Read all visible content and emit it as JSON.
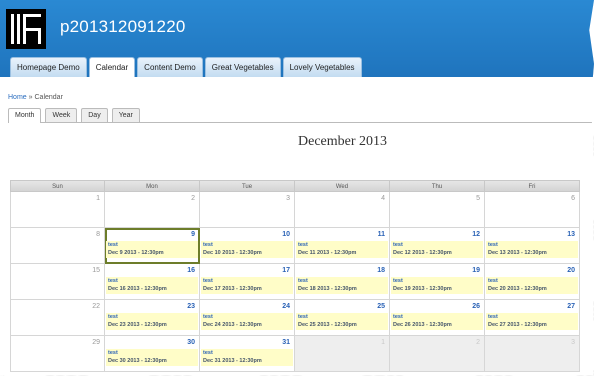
{
  "site": {
    "name": "p201312091220"
  },
  "nav_tabs": [
    {
      "label": "Homepage Demo",
      "active": false
    },
    {
      "label": "Calendar",
      "active": true
    },
    {
      "label": "Content Demo",
      "active": false
    },
    {
      "label": "Great Vegetables",
      "active": false
    },
    {
      "label": "Lovely Vegetables",
      "active": false
    }
  ],
  "breadcrumb": {
    "home": "Home",
    "separator": "»",
    "current": "Calendar"
  },
  "view_tabs": [
    {
      "label": "Month",
      "active": true
    },
    {
      "label": "Week",
      "active": false
    },
    {
      "label": "Day",
      "active": false
    },
    {
      "label": "Year",
      "active": false
    }
  ],
  "calendar": {
    "title": "December 2013",
    "weekdays": [
      "Sun",
      "Mon",
      "Tue",
      "Wed",
      "Thu",
      "Fri"
    ],
    "today": "9",
    "weeks": [
      [
        {
          "day": "1"
        },
        {
          "day": "2"
        },
        {
          "day": "3"
        },
        {
          "day": "4"
        },
        {
          "day": "5"
        },
        {
          "day": "6"
        }
      ],
      [
        {
          "day": "8"
        },
        {
          "day": "9",
          "event": {
            "title": "test",
            "date": "Dec 9 2013 - 12:30pm"
          }
        },
        {
          "day": "10",
          "event": {
            "title": "test",
            "date": "Dec 10 2013 - 12:30pm"
          }
        },
        {
          "day": "11",
          "event": {
            "title": "test",
            "date": "Dec 11 2013 - 12:30pm"
          }
        },
        {
          "day": "12",
          "event": {
            "title": "test",
            "date": "Dec 12 2013 - 12:30pm"
          }
        },
        {
          "day": "13",
          "event": {
            "title": "test",
            "date": "Dec 13 2013 - 12:30pm"
          }
        }
      ],
      [
        {
          "day": "15"
        },
        {
          "day": "16",
          "event": {
            "title": "test",
            "date": "Dec 16 2013 - 12:30pm"
          }
        },
        {
          "day": "17",
          "event": {
            "title": "test",
            "date": "Dec 17 2013 - 12:30pm"
          }
        },
        {
          "day": "18",
          "event": {
            "title": "test",
            "date": "Dec 18 2013 - 12:30pm"
          }
        },
        {
          "day": "19",
          "event": {
            "title": "test",
            "date": "Dec 19 2013 - 12:30pm"
          }
        },
        {
          "day": "20",
          "event": {
            "title": "test",
            "date": "Dec 20 2013 - 12:30pm"
          }
        }
      ],
      [
        {
          "day": "22"
        },
        {
          "day": "23",
          "event": {
            "title": "test",
            "date": "Dec 23 2013 - 12:30pm"
          }
        },
        {
          "day": "24",
          "event": {
            "title": "test",
            "date": "Dec 24 2013 - 12:30pm"
          }
        },
        {
          "day": "25",
          "event": {
            "title": "test",
            "date": "Dec 25 2013 - 12:30pm"
          }
        },
        {
          "day": "26",
          "event": {
            "title": "test",
            "date": "Dec 26 2013 - 12:30pm"
          }
        },
        {
          "day": "27",
          "event": {
            "title": "test",
            "date": "Dec 27 2013 - 12:30pm"
          }
        }
      ],
      [
        {
          "day": "29"
        },
        {
          "day": "30",
          "event": {
            "title": "test",
            "date": "Dec 30 2013 - 12:30pm"
          }
        },
        {
          "day": "31",
          "event": {
            "title": "test",
            "date": "Dec 31 2013 - 12:30pm"
          }
        },
        {
          "day": "1",
          "other": true
        },
        {
          "day": "2",
          "other": true
        },
        {
          "day": "3",
          "other": true
        }
      ]
    ]
  },
  "colors": {
    "header": "#2a89d3",
    "event_bg": "#fffdc8",
    "event_text": "#2a62b6",
    "today_border": "#6d7d2a"
  }
}
